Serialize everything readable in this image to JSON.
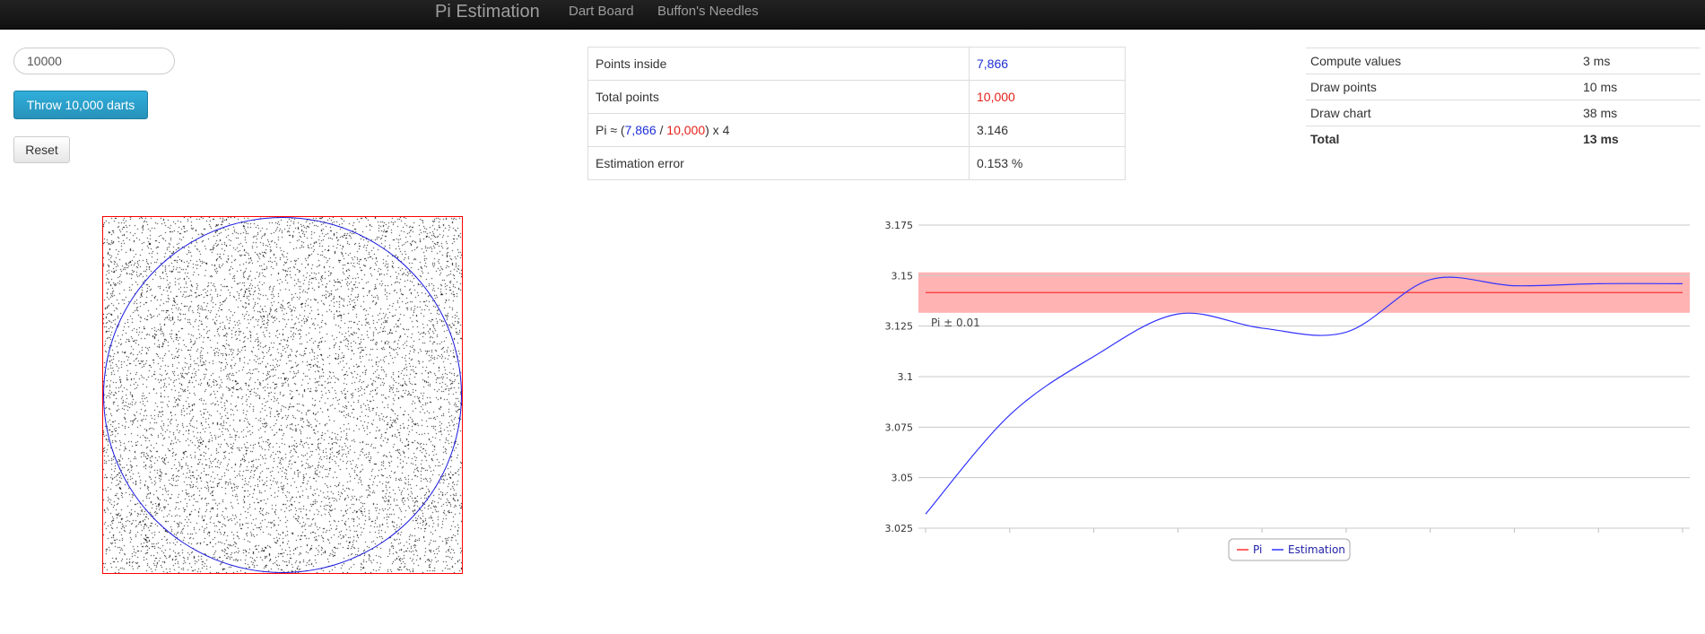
{
  "navbar": {
    "brand": "Pi Estimation",
    "links": [
      "Dart Board",
      "Buffon's Needles"
    ]
  },
  "controls": {
    "count_value": "10000",
    "throw_label": "Throw 10,000 darts",
    "reset_label": "Reset"
  },
  "results": {
    "points_inside_label": "Points inside",
    "points_inside_value": "7,866",
    "total_points_label": "Total points",
    "total_points_value": "10,000",
    "formula_prefix": "Pi ≈ (",
    "formula_inside": "7,866",
    "formula_sep": " / ",
    "formula_total": "10,000",
    "formula_suffix": ") x 4",
    "pi_value": "3.146",
    "error_label": "Estimation error",
    "error_value": "0.153 %"
  },
  "timings": {
    "rows": [
      {
        "label": "Compute values",
        "value": "3 ms"
      },
      {
        "label": "Draw points",
        "value": "10 ms"
      },
      {
        "label": "Draw chart",
        "value": "38 ms"
      },
      {
        "label": "Total",
        "value": "13 ms"
      }
    ]
  },
  "dart_board": {
    "points_shown": 10000,
    "circle_color": "#1a1adf",
    "square_color": "#ff0000",
    "dot_color": "#000000"
  },
  "chart_data": {
    "type": "line",
    "ylim": [
      3.025,
      3.175
    ],
    "yticks": [
      "3.175",
      "3.15",
      "3.125",
      "3.1",
      "3.075",
      "3.05",
      "3.025"
    ],
    "band": {
      "label": "Pi ± 0.01",
      "from": 3.131593,
      "to": 3.151593,
      "color": "#ffb3b3"
    },
    "series": [
      {
        "name": "Pi",
        "color": "#ff3333",
        "values": [
          3.14159,
          3.14159,
          3.14159,
          3.14159,
          3.14159,
          3.14159,
          3.14159,
          3.14159,
          3.14159,
          3.14159
        ]
      },
      {
        "name": "Estimation",
        "color": "#3333ff",
        "values": [
          3.032,
          3.081,
          3.11,
          3.131,
          3.124,
          3.122,
          3.148,
          3.145,
          3.146,
          3.146
        ]
      }
    ],
    "legend": [
      "Pi",
      "Estimation"
    ],
    "legend_position": "bottom"
  }
}
